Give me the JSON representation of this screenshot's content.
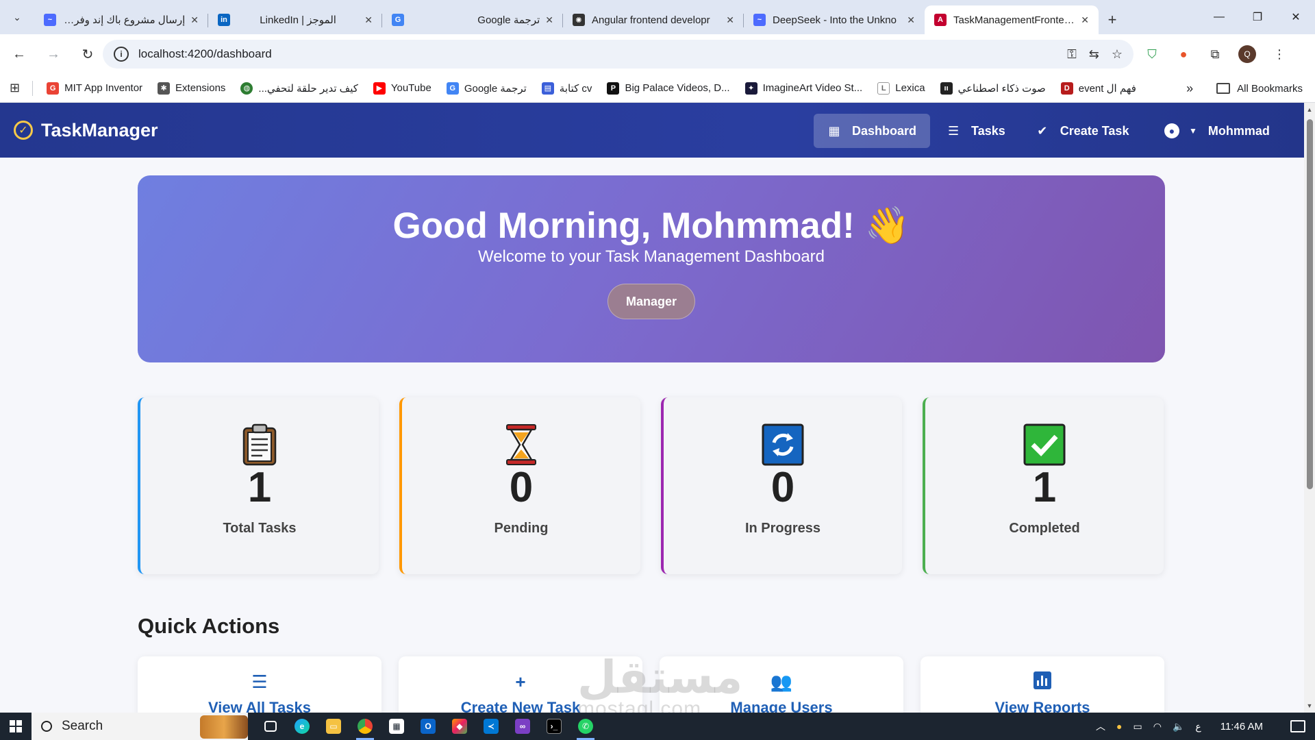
{
  "browser": {
    "tabs": [
      {
        "title": "إرسال مشروع باك إند وفرونت",
        "icon": "deepseek-icon",
        "color": "#4d6bfe",
        "active": false
      },
      {
        "title": "LinkedIn | الموجز",
        "icon": "linkedin-icon",
        "color": "#0a66c2",
        "active": false
      },
      {
        "title": "Google ترجمة",
        "icon": "google-translate-icon",
        "color": "#4285f4",
        "active": false
      },
      {
        "title": "Angular frontend developr",
        "icon": "openai-icon",
        "color": "#333333",
        "active": false
      },
      {
        "title": "DeepSeek - Into the Unkno",
        "icon": "deepseek-icon",
        "color": "#4d6bfe",
        "active": false
      },
      {
        "title": "TaskManagementFrontend",
        "icon": "angular-icon",
        "color": "#c3002f",
        "active": true
      }
    ],
    "url": "localhost:4200/dashboard",
    "bookmarks": [
      {
        "label": "MIT App Inventor",
        "icon": "google-icon",
        "color": "#ea4335"
      },
      {
        "label": "Extensions",
        "icon": "puzzle-icon",
        "color": "#555555"
      },
      {
        "label": "كيف تدير حلقة لتحفي...",
        "icon": "globe-icon",
        "color": "#2e7d32"
      },
      {
        "label": "YouTube",
        "icon": "youtube-icon",
        "color": "#ff0000"
      },
      {
        "label": "Google ترجمة",
        "icon": "google-translate-icon",
        "color": "#4285f4"
      },
      {
        "label": "كتابة cv",
        "icon": "document-icon",
        "color": "#3b5fd9"
      },
      {
        "label": "Big Palace Videos, D...",
        "icon": "video-icon",
        "color": "#111111"
      },
      {
        "label": "ImagineArt Video St...",
        "icon": "imagineart-icon",
        "color": "#1a1a3a"
      },
      {
        "label": "Lexica",
        "icon": "lexica-icon",
        "color": "#666666"
      },
      {
        "label": "صوت ذكاء اصطناعي",
        "icon": "audio-icon",
        "color": "#222222"
      },
      {
        "label": "فهم ال event",
        "icon": "bookmark-icon",
        "color": "#b71c1c"
      }
    ],
    "all_bookmarks_label": "All Bookmarks",
    "profile_initial": "Q"
  },
  "app": {
    "brand": "TaskManager",
    "nav": [
      {
        "label": "Dashboard",
        "icon": "dashboard-icon",
        "active": true
      },
      {
        "label": "Tasks",
        "icon": "list-icon",
        "active": false
      },
      {
        "label": "Create Task",
        "icon": "check-circle-icon",
        "active": false
      }
    ],
    "user_name": "Mohmmad",
    "hero": {
      "title": "Good Morning, Mohmmad! 👋",
      "subtitle": "Welcome to your Task Management Dashboard",
      "role": "Manager"
    },
    "stats": [
      {
        "value": "1",
        "label": "Total Tasks",
        "icon": "clipboard-icon",
        "color": "#2196f3"
      },
      {
        "value": "0",
        "label": "Pending",
        "icon": "hourglass-icon",
        "color": "#ff9800"
      },
      {
        "value": "0",
        "label": "In Progress",
        "icon": "refresh-icon",
        "color": "#9c27b0"
      },
      {
        "value": "1",
        "label": "Completed",
        "icon": "checkmark-icon",
        "color": "#4caf50"
      }
    ],
    "quick_actions_title": "Quick Actions",
    "quick_actions": [
      {
        "label": "View All Tasks",
        "icon": "list-icon"
      },
      {
        "label": "Create New Task",
        "icon": "plus-icon"
      },
      {
        "label": "Manage Users",
        "icon": "users-icon"
      },
      {
        "label": "View Reports",
        "icon": "chart-icon"
      }
    ],
    "watermark": "مستقل",
    "watermark_latin": "mostaql.com"
  },
  "taskbar": {
    "search_label": "Search",
    "input_indicator": "ع",
    "time": "11:46 AM"
  }
}
